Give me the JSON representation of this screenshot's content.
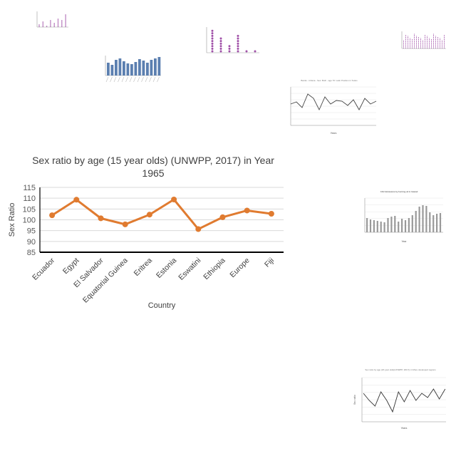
{
  "chart_data": {
    "type": "line",
    "title": "Sex ratio by age (15 year olds) (UNWPP, 2017) in Year 1965",
    "xlabel": "Country",
    "ylabel": "Sex Ratio",
    "categories": [
      "Ecuador",
      "Egypt",
      "El Salvador",
      "Equatorial Guinea",
      "Eritrea",
      "Estonia",
      "Eswatini",
      "Ethiopia",
      "Europe",
      "Fiji"
    ],
    "values": [
      102.1,
      109.3,
      100.7,
      97.9,
      102.4,
      109.4,
      95.7,
      101.2,
      104.3,
      102.8
    ],
    "ylim": [
      85,
      115
    ],
    "yticks": [
      85,
      90,
      95,
      100,
      105,
      110,
      115
    ],
    "color": "#e07b30",
    "grid": true
  },
  "thumbnails": {
    "t1": {
      "color": "#a050a8"
    },
    "t2": {
      "color": "#5b7fb0"
    },
    "t3": {
      "color": "#a050a8"
    },
    "t4": {
      "color": "#a050a8"
    },
    "t5": {
      "title": "Banks - Ghana - Sex: Both - age 70: Latin Position in Todos",
      "color": "#444444",
      "xlabel": "Years"
    },
    "t6": {
      "title": "CO2 Emissions by burning oil in Ireland",
      "color": "#999999",
      "xlabel": "Year"
    },
    "t7": {
      "title": "Sex ratio by age (20 year olds)(UNWPP, 2017)) in More developed regions",
      "color": "#333333",
      "xlabel": "Years",
      "ylabel": "Sex ratio"
    }
  }
}
